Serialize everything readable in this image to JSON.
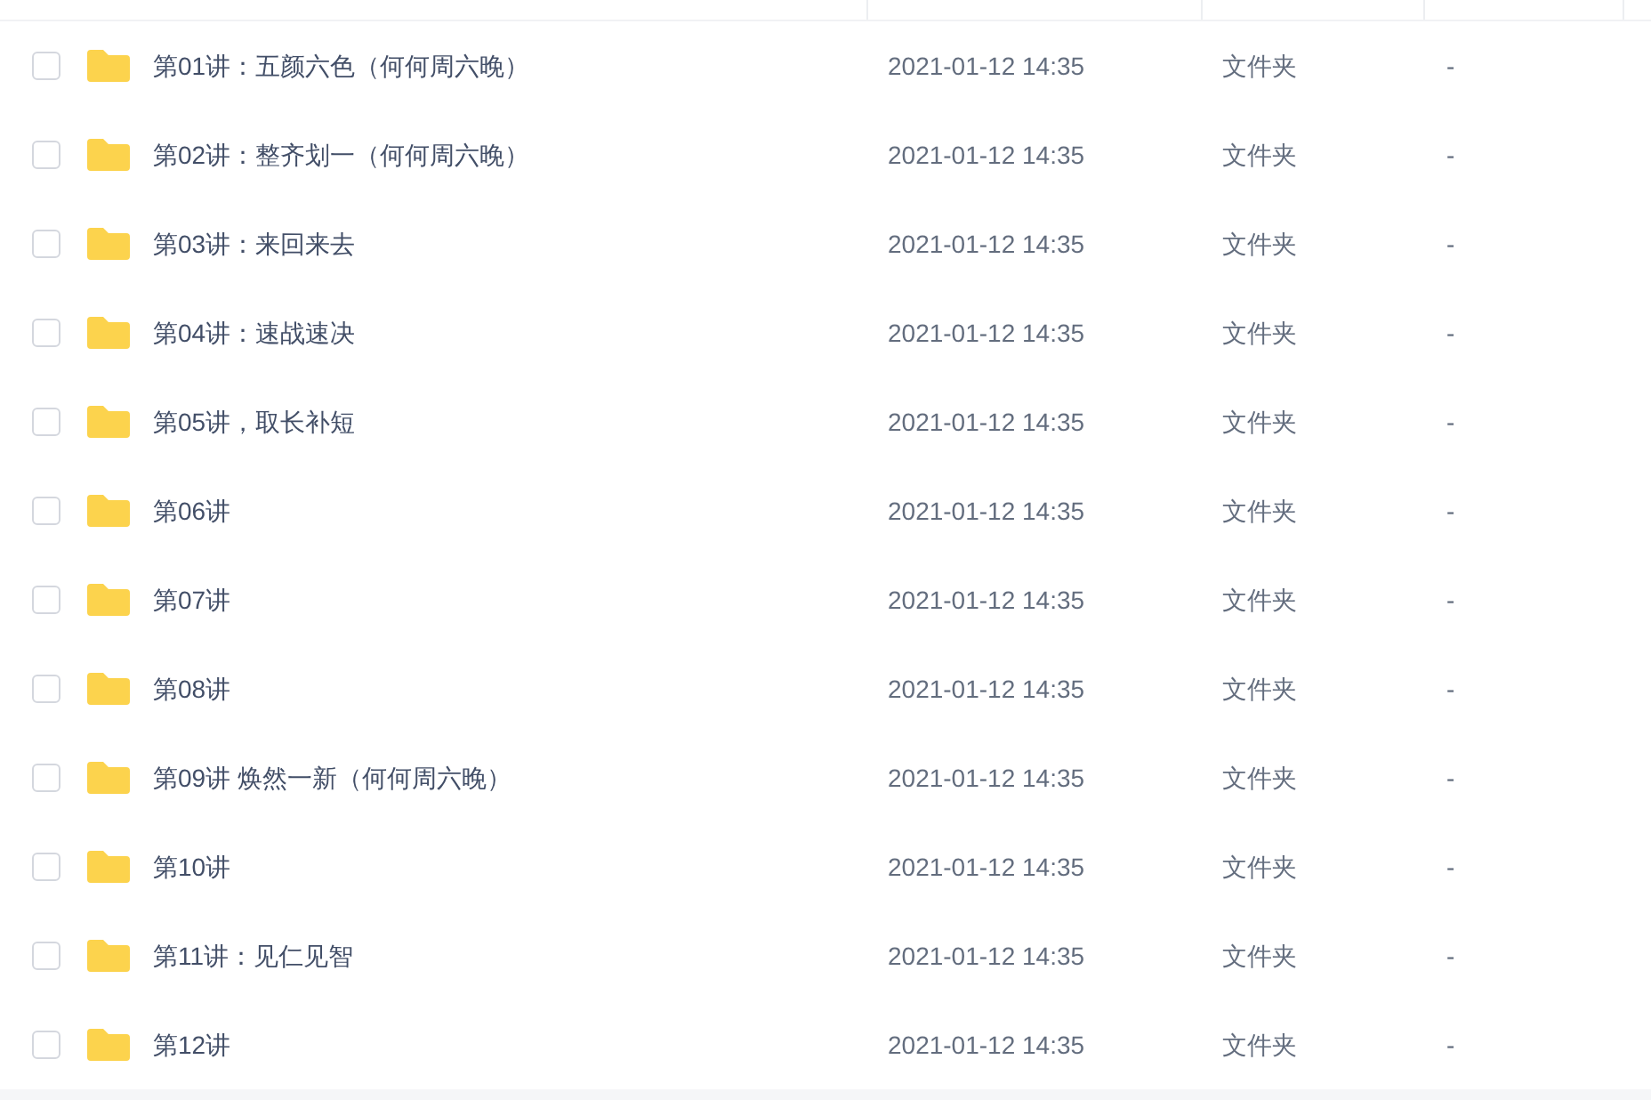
{
  "files": [
    {
      "name": "第01讲：五颜六色（何何周六晚）",
      "modified": "2021-01-12 14:35",
      "type": "文件夹",
      "size": "-",
      "checked": false
    },
    {
      "name": "第02讲：整齐划一（何何周六晚）",
      "modified": "2021-01-12 14:35",
      "type": "文件夹",
      "size": "-",
      "checked": false
    },
    {
      "name": "第03讲：来回来去",
      "modified": "2021-01-12 14:35",
      "type": "文件夹",
      "size": "-",
      "checked": false
    },
    {
      "name": "第04讲：速战速决",
      "modified": "2021-01-12 14:35",
      "type": "文件夹",
      "size": "-",
      "checked": false
    },
    {
      "name": "第05讲，取长补短",
      "modified": "2021-01-12 14:35",
      "type": "文件夹",
      "size": "-",
      "checked": false
    },
    {
      "name": "第06讲",
      "modified": "2021-01-12 14:35",
      "type": "文件夹",
      "size": "-",
      "checked": false
    },
    {
      "name": "第07讲",
      "modified": "2021-01-12 14:35",
      "type": "文件夹",
      "size": "-",
      "checked": false
    },
    {
      "name": "第08讲",
      "modified": "2021-01-12 14:35",
      "type": "文件夹",
      "size": "-",
      "checked": false
    },
    {
      "name": "第09讲 焕然一新（何何周六晚）",
      "modified": "2021-01-12 14:35",
      "type": "文件夹",
      "size": "-",
      "checked": false
    },
    {
      "name": "第10讲",
      "modified": "2021-01-12 14:35",
      "type": "文件夹",
      "size": "-",
      "checked": false
    },
    {
      "name": "第11讲：见仁见智",
      "modified": "2021-01-12 14:35",
      "type": "文件夹",
      "size": "-",
      "checked": false
    },
    {
      "name": "第12讲",
      "modified": "2021-01-12 14:35",
      "type": "文件夹",
      "size": "-",
      "checked": false
    }
  ]
}
